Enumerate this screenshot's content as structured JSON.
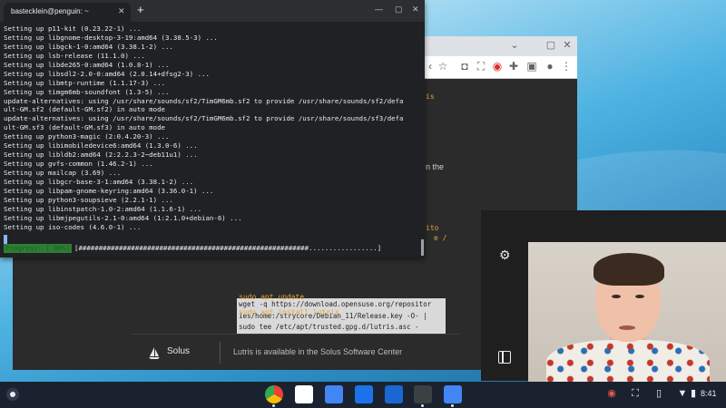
{
  "terminal": {
    "tab_title": "bastecklein@penguin: ~",
    "tab_close": "✕",
    "new_tab": "+",
    "lines": [
      "Setting up p11-kit (0.23.22-1) ...",
      "Setting up libgnome-desktop-3-19:amd64 (3.38.5-3) ...",
      "Setting up libgck-1-0:amd64 (3.38.1-2) ...",
      "Setting up lsb-release (11.1.0) ...",
      "Setting up libde265-0:amd64 (1.0.8-1) ...",
      "Setting up libsdl2-2.0-0:amd64 (2.0.14+dfsg2-3) ...",
      "Setting up libmtp-runtime (1.1.17-3) ...",
      "Setting up timgm6mb-soundfont (1.3-5) ...",
      "update-alternatives: using /usr/share/sounds/sf2/TimGM6mb.sf2 to provide /usr/share/sounds/sf2/defa",
      "ult-GM.sf2 (default-GM.sf2) in auto mode",
      "update-alternatives: using /usr/share/sounds/sf2/TimGM6mb.sf2 to provide /usr/share/sounds/sf3/defa",
      "ult-GM.sf3 (default-GM.sf3) in auto mode",
      "Setting up python3-magic (2:0.4.20-3) ...",
      "Setting up libimobiledevice6:amd64 (1.3.0-6) ...",
      "Setting up libldb2:amd64 (2:2.2.3-2~deb11u1) ...",
      "Setting up gvfs-common (1.46.2-1) ...",
      "Setting up mailcap (3.69) ...",
      "Setting up libgcr-base-3-1:amd64 (3.38.1-2) ...",
      "Setting up libpam-gnome-keyring:amd64 (3.36.0-1) ...",
      "Setting up python3-soupsieve (2.2.1-1) ...",
      "Setting up libinstpatch-1.0-2:amd64 (1.1.6-1) ...",
      "Setting up libmjpegutils-2.1-0:amd64 (1:2.1.0+debian-6) ...",
      "Setting up iso-codes (4.6.0-1) ..."
    ],
    "progress_label": "Progress: [ 88%]",
    "progress_bar": "[#########################################################.................]"
  },
  "browser": {
    "code_lines": [
      "wget -q https://download.opensuse.org/repositor",
      "ies/home:/strycore/Debian_11/Release.key -O- |",
      "sudo tee /etc/apt/trusted.gpg.d/lutris.asc -"
    ],
    "cmd_update": "sudo apt update",
    "cmd_install": "sudo apt install lutris",
    "frag_is": "is",
    "frag_the": "n the",
    "frag_ito": "ito",
    "frag_e": "e /",
    "solus_name": "Solus",
    "solus_text": "Lutris is available in the Solus Software Center"
  },
  "shelf": {
    "time": "8:41"
  },
  "colors": {
    "terminal_bg": "#202124",
    "progress_green": "#2e7d32",
    "code_orange": "#e8a33a",
    "shelf_bg": "#1a2230"
  },
  "icons": [
    "launcher-icon",
    "chrome-icon",
    "gmail-icon",
    "docs-icon",
    "files-icon",
    "calendar-icon",
    "terminal-icon",
    "camera-icon",
    "screen-record-icon",
    "screenshot-icon",
    "phone-hub-icon",
    "wifi-icon",
    "battery-icon",
    "gear-icon"
  ]
}
